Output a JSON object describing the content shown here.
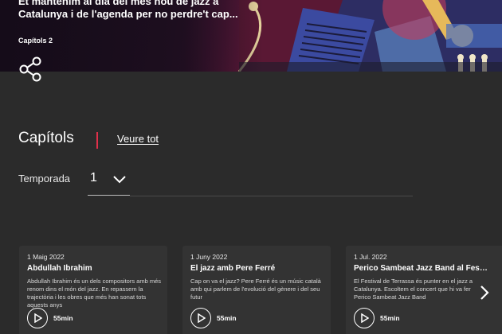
{
  "hero": {
    "description": "Et mantenim al dia del més nou de jazz a Catalunya i de l'agenda per no perdre't cap...",
    "chapters_count": "Capítols 2"
  },
  "share": {
    "icon": "share-icon"
  },
  "chapters": {
    "title": "Capítols",
    "see_all_label": "Veure tot",
    "accent_color": "#e0304a"
  },
  "season": {
    "label": "Temporada",
    "selected": "1",
    "icon": "chevron-down-icon"
  },
  "episodes": [
    {
      "date": "1 Maig 2022",
      "title": "Abdullah Ibrahim",
      "description": "Abdullah Ibrahim és un dels compositors amb més renom dins el món del jazz. En repassem la trajectòria i les obres que més han sonat tots aquests anys",
      "duration": "55min"
    },
    {
      "date": "1 Juny 2022",
      "title": "El jazz amb Pere Ferré",
      "description": "Cap on va el jazz? Pere Ferré és un músic català amb qui parlem de l'evolució del gènere i del seu futur",
      "duration": "55min"
    },
    {
      "date": "1 Jul. 2022",
      "title": "Perico Sambeat Jazz Band al Festiv...",
      "description": "El Festival de Terrassa és punter en el jazz a Catalunya. Escoltem el concert que hi va fer Perico Sambeat Jazz Band",
      "duration": "55min"
    }
  ],
  "carousel": {
    "next_icon": "chevron-right-icon"
  }
}
